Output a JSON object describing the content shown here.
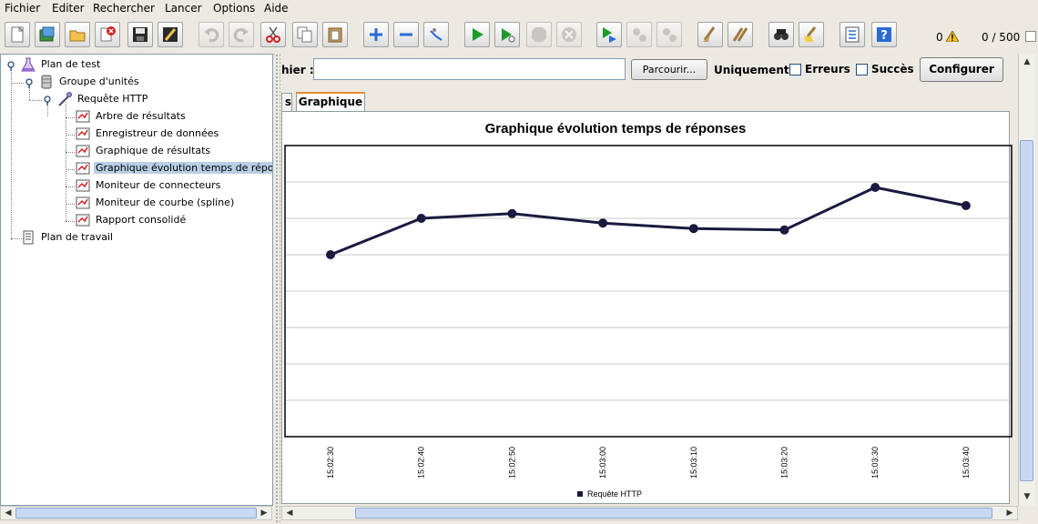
{
  "menu": [
    "Fichier",
    "Editer",
    "Rechercher",
    "Lancer",
    "Options",
    "Aide"
  ],
  "toolbar": {
    "warnings_count": "0",
    "threads": "0 / 500",
    "icons": [
      "new-icon",
      "templates-icon",
      "open-icon",
      "close-icon",
      "save-icon",
      "edit-icon",
      "undo-icon",
      "redo-icon",
      "cut-icon",
      "copy-icon",
      "paste-icon",
      "expand-icon",
      "collapse-icon",
      "toggle-icon",
      "start-icon",
      "start-no-pause-icon",
      "stop-icon",
      "shutdown-icon",
      "remote-start-icon",
      "remote-stop-icon",
      "remote-shutdown-icon",
      "clear-icon",
      "clear-all-icon",
      "search-icon",
      "reset-search-icon",
      "function-helper-icon",
      "help-icon"
    ]
  },
  "tree": {
    "nodes": [
      {
        "label": "Plan de test",
        "icon": "test-plan-icon"
      },
      {
        "label": "Groupe d'unités",
        "icon": "thread-group-icon"
      },
      {
        "label": "Requête HTTP",
        "icon": "http-sampler-icon"
      },
      {
        "label": "Arbre de résultats",
        "icon": "listener-icon"
      },
      {
        "label": "Enregistreur de données",
        "icon": "listener-icon"
      },
      {
        "label": "Graphique de résultats",
        "icon": "listener-icon"
      },
      {
        "label": "Graphique évolution temps de réponses",
        "icon": "listener-icon"
      },
      {
        "label": "Moniteur de connecteurs",
        "icon": "listener-icon"
      },
      {
        "label": "Moniteur de courbe (spline)",
        "icon": "listener-icon"
      },
      {
        "label": "Rapport consolidé",
        "icon": "listener-icon"
      },
      {
        "label": "Plan de travail",
        "icon": "workbench-icon"
      }
    ]
  },
  "file_panel": {
    "label": "hier :",
    "file_value": "",
    "browse_label": "Parcourir...",
    "only_label": "Uniquement :",
    "errors_label": "Erreurs",
    "success_label": "Succès",
    "errors_checked": false,
    "success_checked": false,
    "configure_label": "Configurer"
  },
  "tabs": {
    "previous_partial": "s",
    "active": "Graphique"
  },
  "chart_data": {
    "type": "line",
    "title": "Graphique évolution temps de réponses",
    "x": [
      "15:02:30",
      "15:02:40",
      "15:02:50",
      "15:03:00",
      "15:03:10",
      "15:03:20",
      "15:03:30",
      "15:03:40"
    ],
    "series": [
      {
        "name": "Requête HTTP",
        "values": [
          50.0,
          60.0,
          61.3,
          58.7,
          57.2,
          56.8,
          68.5,
          63.5
        ],
        "color": "#1a1a40"
      }
    ],
    "ylim": [
      0,
      80
    ],
    "grid": true,
    "legend_position": "bottom"
  }
}
